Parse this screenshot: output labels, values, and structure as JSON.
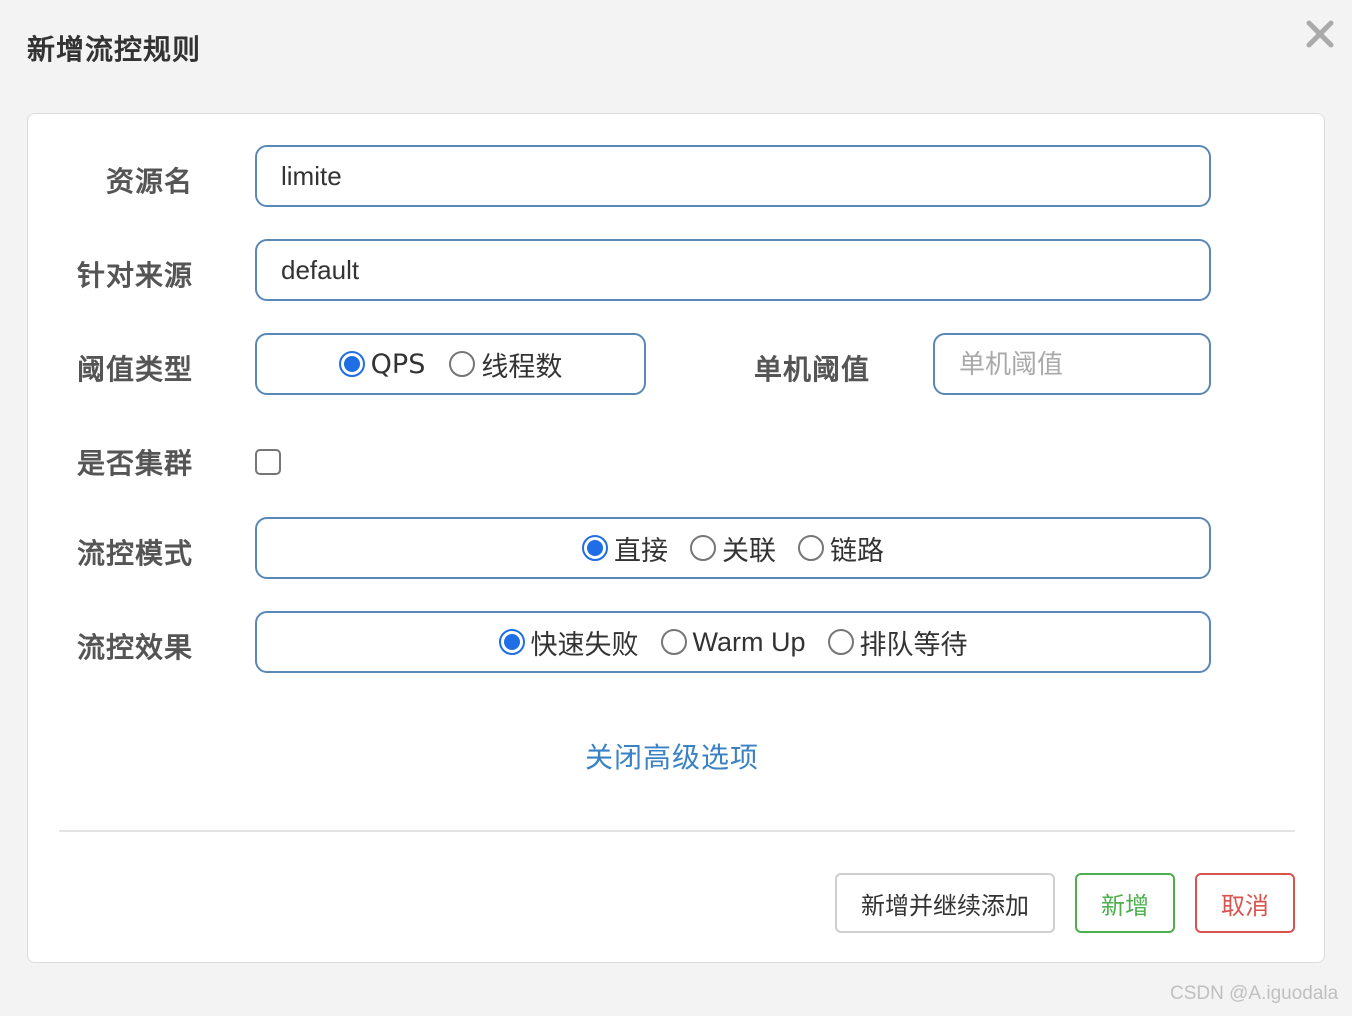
{
  "dialog": {
    "title": "新增流控规则",
    "close_icon": "close-icon"
  },
  "form": {
    "resource": {
      "label": "资源名",
      "value": "limite"
    },
    "origin": {
      "label": "针对来源",
      "value": "default"
    },
    "threshold_type": {
      "label": "阈值类型",
      "options": [
        "QPS",
        "线程数"
      ],
      "selected": "QPS"
    },
    "single_threshold": {
      "label": "单机阈值",
      "placeholder": "单机阈值",
      "value": ""
    },
    "cluster": {
      "label": "是否集群",
      "checked": false
    },
    "control_mode": {
      "label": "流控模式",
      "options": [
        "直接",
        "关联",
        "链路"
      ],
      "selected": "直接"
    },
    "control_effect": {
      "label": "流控效果",
      "options": [
        "快速失败",
        "Warm Up",
        "排队等待"
      ],
      "selected": "快速失败"
    },
    "advanced_link": "关闭高级选项"
  },
  "buttons": {
    "add_continue": "新增并继续添加",
    "add": "新增",
    "cancel": "取消"
  },
  "colors": {
    "input_border": "#5a87b6",
    "radio_checked": "#1f6ee6",
    "link": "#3b82c4",
    "success": "#4cae4c",
    "danger": "#d9534f"
  },
  "watermark": "CSDN @A.iguodala"
}
